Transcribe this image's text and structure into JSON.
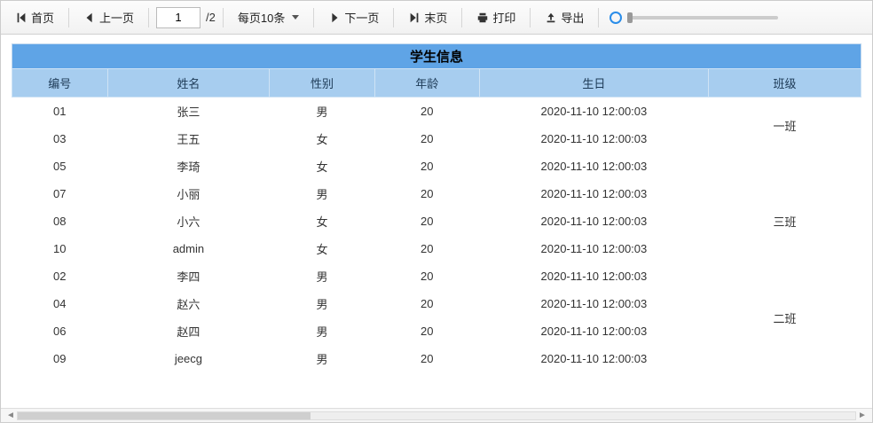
{
  "toolbar": {
    "first_label": "首页",
    "prev_label": "上一页",
    "page_value": "1",
    "page_total": "/2",
    "page_size_label": "每页10条",
    "next_label": "下一页",
    "last_label": "末页",
    "print_label": "打印",
    "export_label": "导出"
  },
  "table": {
    "title": "学生信息",
    "headers": {
      "id": "编号",
      "name": "姓名",
      "sex": "性别",
      "age": "年龄",
      "birthday": "生日",
      "class": "班级"
    },
    "rows": [
      {
        "id": "01",
        "name": "张三",
        "sex": "男",
        "age": "20",
        "birthday": "2020-11-10 12:00:03"
      },
      {
        "id": "03",
        "name": "王五",
        "sex": "女",
        "age": "20",
        "birthday": "2020-11-10 12:00:03"
      },
      {
        "id": "05",
        "name": "李琦",
        "sex": "女",
        "age": "20",
        "birthday": "2020-11-10 12:00:03"
      },
      {
        "id": "07",
        "name": "小丽",
        "sex": "男",
        "age": "20",
        "birthday": "2020-11-10 12:00:03"
      },
      {
        "id": "08",
        "name": "小六",
        "sex": "女",
        "age": "20",
        "birthday": "2020-11-10 12:00:03"
      },
      {
        "id": "10",
        "name": "admin",
        "sex": "女",
        "age": "20",
        "birthday": "2020-11-10 12:00:03"
      },
      {
        "id": "02",
        "name": "李四",
        "sex": "男",
        "age": "20",
        "birthday": "2020-11-10 12:00:03"
      },
      {
        "id": "04",
        "name": "赵六",
        "sex": "男",
        "age": "20",
        "birthday": "2020-11-10 12:00:03"
      },
      {
        "id": "06",
        "name": "赵四",
        "sex": "男",
        "age": "20",
        "birthday": "2020-11-10 12:00:03"
      },
      {
        "id": "09",
        "name": "jeecg",
        "sex": "男",
        "age": "20",
        "birthday": "2020-11-10 12:00:03"
      }
    ],
    "class_groups": [
      {
        "label": "一班",
        "start": 0,
        "span": 2
      },
      {
        "label": "",
        "start": 2,
        "span": 1
      },
      {
        "label": "",
        "start": 3,
        "span": 1
      },
      {
        "label": "三班",
        "start": 4,
        "span": 1
      },
      {
        "label": "",
        "start": 5,
        "span": 1
      },
      {
        "label": "",
        "start": 6,
        "span": 1
      },
      {
        "label": "二班",
        "start": 7,
        "span": 2
      },
      {
        "label": "",
        "start": 9,
        "span": 1
      }
    ]
  }
}
